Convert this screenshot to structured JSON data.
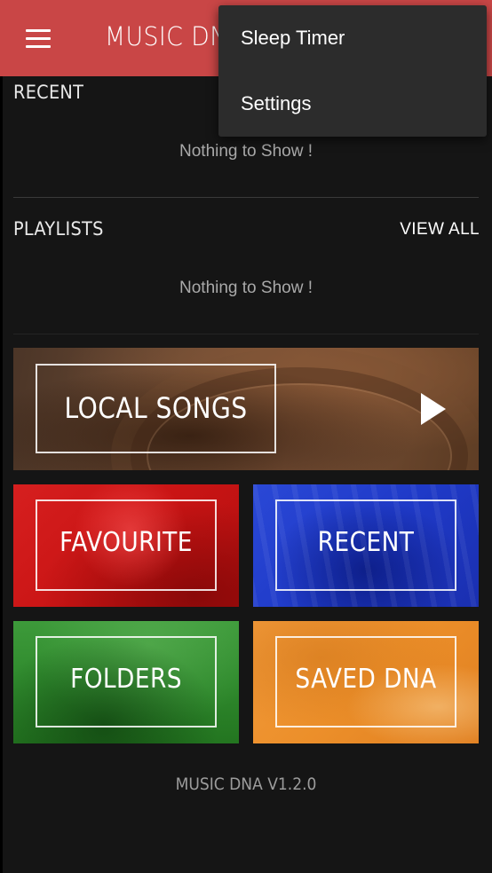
{
  "appbar": {
    "title": "MUSIC DN",
    "menu_icon": "hamburger-menu-icon",
    "color": "#c94646"
  },
  "recent": {
    "title": "RECENT",
    "empty_text": "Nothing to Show !"
  },
  "playlists": {
    "title": "PLAYLISTS",
    "view_all_label": "VIEW ALL",
    "empty_text": "Nothing to Show !"
  },
  "tiles": {
    "local_songs": {
      "label": "LOCAL SONGS",
      "icon": "play-icon"
    },
    "favourite": {
      "label": "FAVOURITE",
      "color": "#d61f1f"
    },
    "recent": {
      "label": "RECENT",
      "color": "#2a48d6"
    },
    "folders": {
      "label": "FOLDERS",
      "color": "#2f8a2d"
    },
    "saved_dna": {
      "label": "SAVED DNA",
      "color": "#ec8f2a"
    }
  },
  "footer": {
    "version": "MUSIC DNA V1.2.0"
  },
  "overflow_menu": {
    "items": [
      {
        "label": "Sleep Timer"
      },
      {
        "label": "Settings"
      }
    ]
  }
}
